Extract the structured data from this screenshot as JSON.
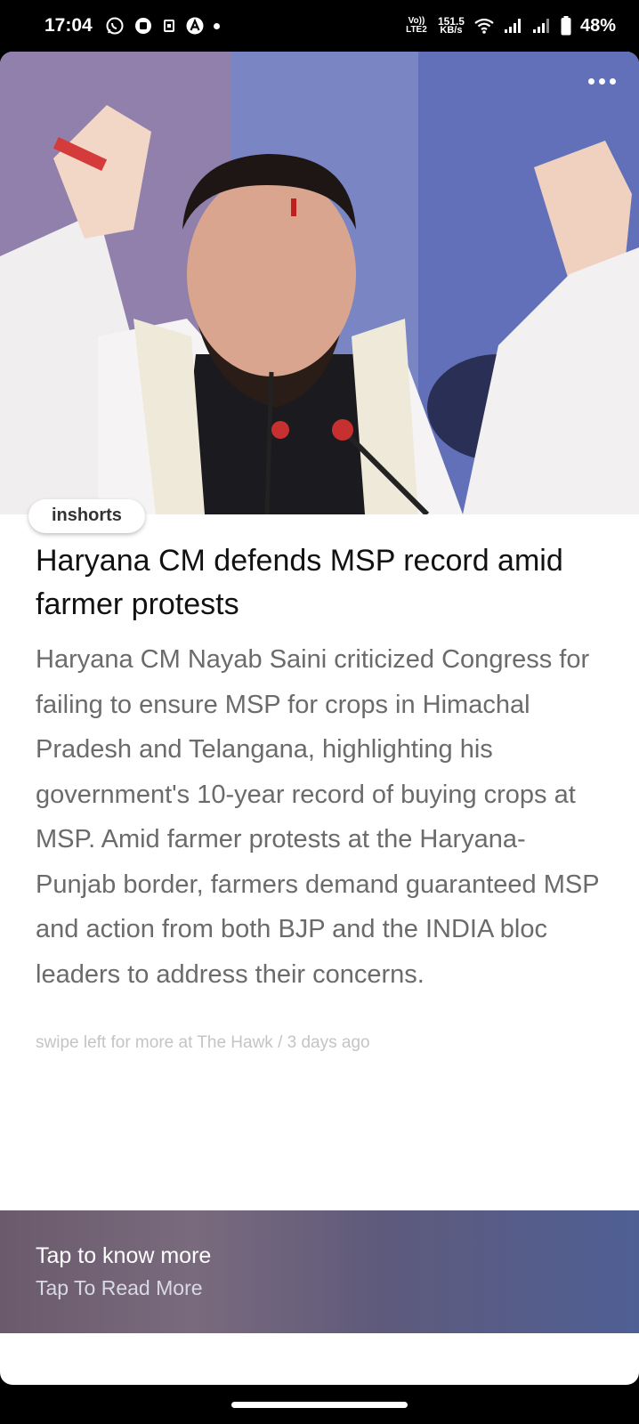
{
  "status_bar": {
    "time": "17:04",
    "notification_icons": [
      "whatsapp-icon",
      "app-icon",
      "sim-icon",
      "a-icon"
    ],
    "volte": "Vo)) LTE2",
    "net_speed_value": "151.5",
    "net_speed_unit": "KB/s",
    "battery": "48%"
  },
  "article": {
    "brand": "inshorts",
    "headline": "Haryana CM defends MSP record amid farmer protests",
    "body": "Haryana CM Nayab Saini criticized Congress for failing to ensure MSP for crops in Himachal Pradesh and Telangana, highlighting his government's 10-year record of buying crops at MSP. Amid farmer protests at the Haryana-Punjab border, farmers demand guaranteed MSP and action from both BJP and the INDIA bloc leaders to address their concerns.",
    "source_line": "swipe left for more at The Hawk / 3 days ago"
  },
  "footer": {
    "title": "Tap to know more",
    "subtitle": "Tap To Read More"
  }
}
